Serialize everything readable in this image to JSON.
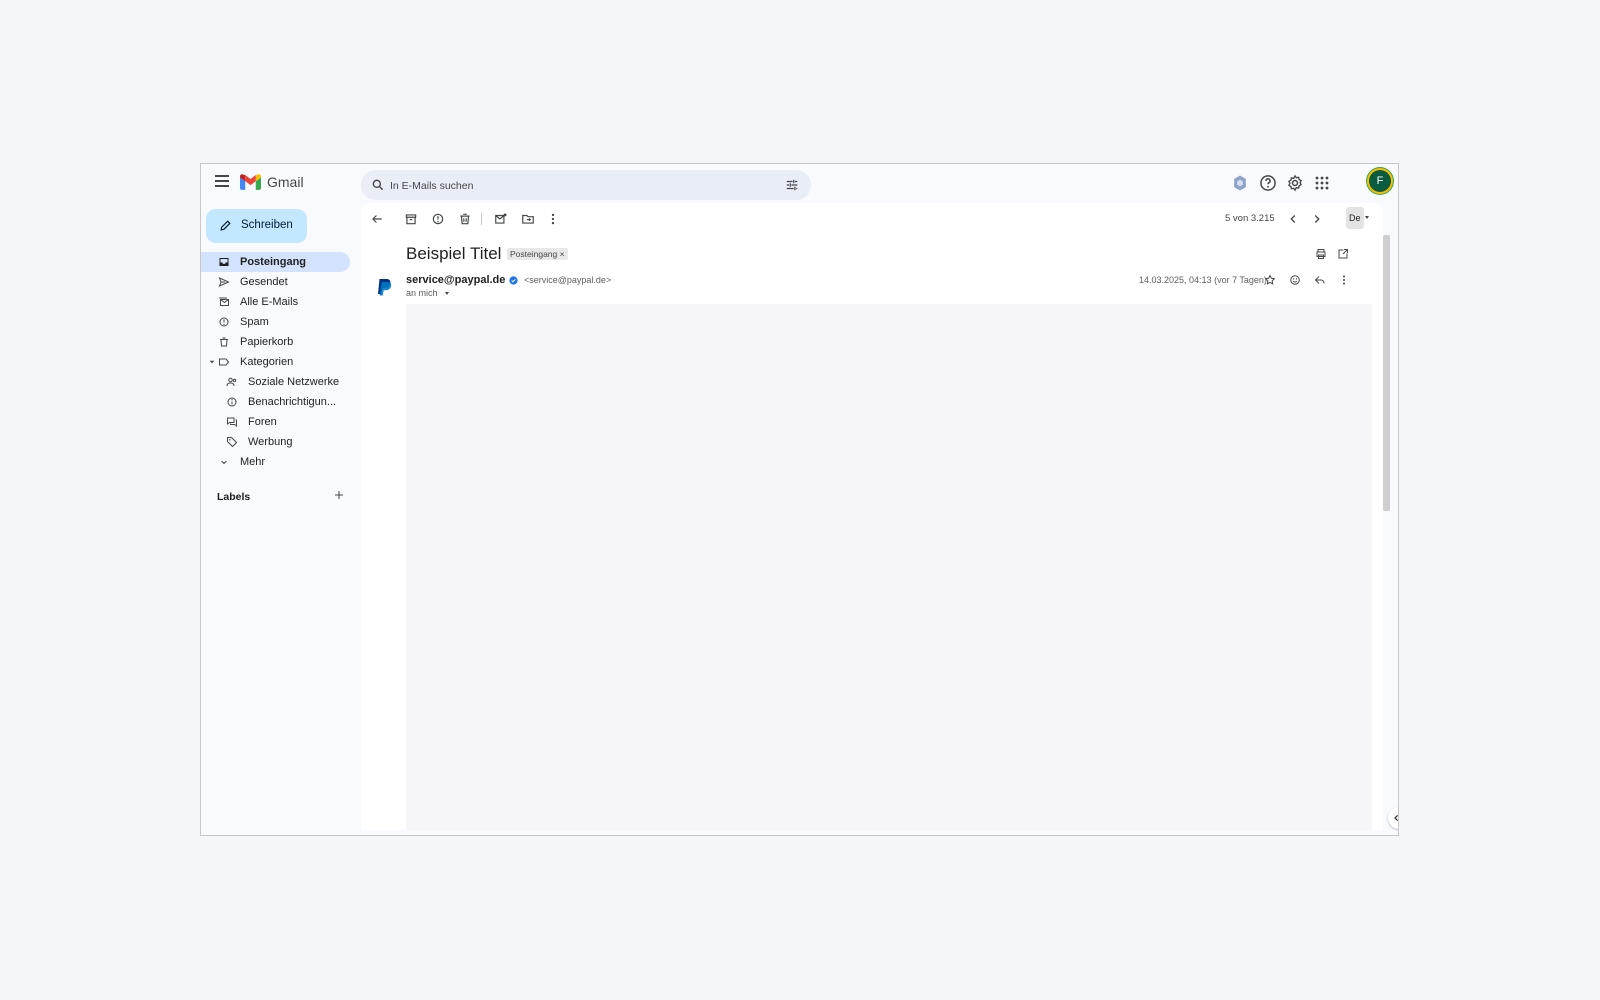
{
  "app": {
    "name": "Gmail"
  },
  "search": {
    "placeholder": "In E-Mails suchen"
  },
  "account": {
    "avatar_letter": "F"
  },
  "compose": {
    "label": "Schreiben"
  },
  "sidebar": {
    "items": [
      {
        "label": "Posteingang",
        "icon": "inbox-icon",
        "active": true
      },
      {
        "label": "Gesendet",
        "icon": "send-icon"
      },
      {
        "label": "Alle E-Mails",
        "icon": "all-mail-icon"
      },
      {
        "label": "Spam",
        "icon": "spam-icon"
      },
      {
        "label": "Papierkorb",
        "icon": "trash-icon"
      },
      {
        "label": "Kategorien",
        "icon": "label-icon"
      },
      {
        "label": "Soziale Netzwerke",
        "icon": "people-icon"
      },
      {
        "label": "Benachrichtigun...",
        "icon": "info-icon"
      },
      {
        "label": "Foren",
        "icon": "forum-icon"
      },
      {
        "label": "Werbung",
        "icon": "tag-icon"
      },
      {
        "label": "Mehr",
        "icon": "chevron-down-icon"
      }
    ],
    "labels_heading": "Labels"
  },
  "toolbar": {
    "pager": "5 von 3.215",
    "lang": "De"
  },
  "message": {
    "subject": "Beispiel Titel",
    "label_chip": "Posteingang ×",
    "sender_name": "service@paypal.de",
    "sender_email": "<service@paypal.de>",
    "recipient": "an mich",
    "date": "14.03.2025, 04:13 (vor 7 Tagen)"
  },
  "colors": {
    "active_nav": "#d3e3fd",
    "compose_bg": "#c2e7ff",
    "search_bg": "#e9eef6",
    "avatar_bg": "#0b5b41"
  }
}
